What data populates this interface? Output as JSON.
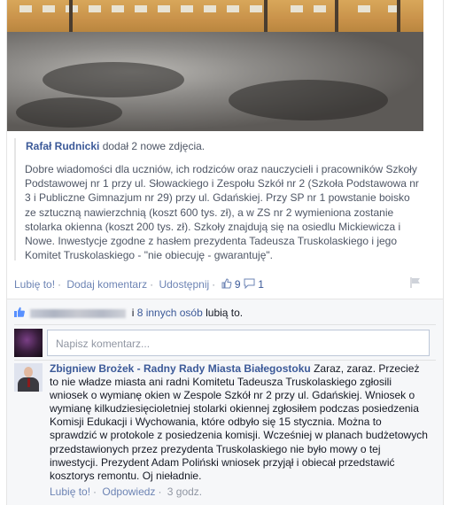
{
  "post": {
    "author": "Rafał Rudnicki",
    "action": "dodał 2 nowe zdjęcia.",
    "text": "Dobre wiadomości dla uczniów, ich rodziców oraz nauczycieli i pracowników Szkoły Podstawowej nr 1 przy ul. Słowackiego i Zespołu Szkół nr 2 (Szkoła Podstawowa nr 3 i Publiczne Gimnazjum nr 29) przy ul. Gdańskiej. Przy SP nr 1 powstanie boisko ze sztuczną nawierzchnią (koszt 600 tys. zł), a w ZS nr 2 wymieniona zostanie stolarka okienna (koszt 200 tys. zł). Szkoły znajdują się na osiedlu Mickiewicza i Nowe. Inwestycje zgodne z hasłem prezydenta Tadeusza Truskolaskiego i jego Komitet Truskolaskiego - \"nie obiecuję - gwarantuję\".",
    "actions": {
      "like": "Lubię to!",
      "comment": "Dodaj komentarz",
      "share": "Udostępnij",
      "like_count": "9",
      "comment_count": "1"
    }
  },
  "likes": {
    "and_text": "i",
    "others_link": "8 innych osób",
    "suffix": "lubią to."
  },
  "comment_input": {
    "placeholder": "Napisz komentarz..."
  },
  "comment": {
    "author": "Zbigniew Brożek - Radny Rady Miasta Białegostoku",
    "text": "Zaraz, zaraz. Przecież to nie władze miasta ani radni Komitetu Tadeusza Truskolaskiego zgłosili wniosek o wymianę okien w Zespole Szkół nr 2 przy ul. Gdańskiej. Wniosek o wymianę kilkudziesięcioletniej stolarki okiennej zgłosiłem podczas posiedzenia Komisji Edukacji i Wychowania, które odbyło się 15 stycznia. Można to sprawdzić w protokole z posiedzenia komisji. Wcześniej w planach budżetowych przedstawionych przez prezydenta Truskolaskiego nie było mowy o tej inwestycji. Prezydent Adam Poliński wniosek przyjął i obiecał przedstawić kosztorys remontu. Oj nieładnie.",
    "like": "Lubię to!",
    "reply": "Odpowiedz",
    "time": "3 godz."
  },
  "colors": {
    "link": "#3b5998",
    "action_link": "#6d84b4",
    "muted": "#9197a3",
    "feedback_bg": "#f6f7f9"
  },
  "icons": [
    "thumbs-up-icon",
    "speech-bubble-icon",
    "flag-icon",
    "like-summary-icon"
  ]
}
